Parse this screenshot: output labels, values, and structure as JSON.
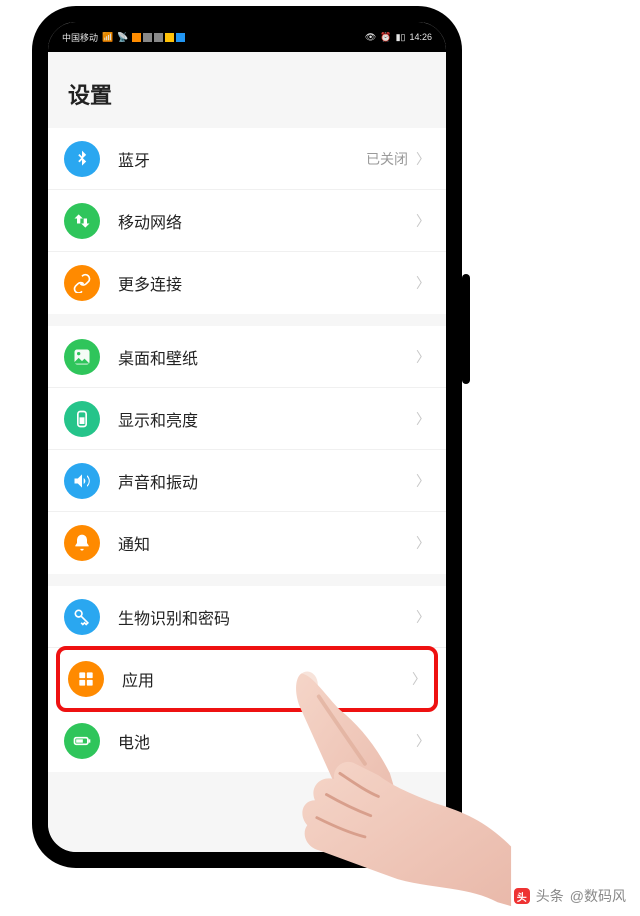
{
  "statusbar": {
    "carrier": "中国移动",
    "signal": "4G+",
    "time": "14:26",
    "battery_icon": "battery"
  },
  "page": {
    "title": "设置"
  },
  "items": [
    {
      "label": "蓝牙",
      "value": "已关闭",
      "icon": "bluetooth",
      "color": "bg-blue"
    },
    {
      "label": "移动网络",
      "value": "",
      "icon": "arrows",
      "color": "bg-green"
    },
    {
      "label": "更多连接",
      "value": "",
      "icon": "link",
      "color": "bg-orange"
    },
    {
      "label": "桌面和壁纸",
      "value": "",
      "icon": "image",
      "color": "bg-green"
    },
    {
      "label": "显示和亮度",
      "value": "",
      "icon": "brightness",
      "color": "bg-teal"
    },
    {
      "label": "声音和振动",
      "value": "",
      "icon": "sound",
      "color": "bg-blue"
    },
    {
      "label": "通知",
      "value": "",
      "icon": "bell",
      "color": "bg-orange"
    },
    {
      "label": "生物识别和密码",
      "value": "",
      "icon": "key",
      "color": "bg-blue"
    },
    {
      "label": "应用",
      "value": "",
      "icon": "apps",
      "color": "bg-orange",
      "highlight": true
    },
    {
      "label": "电池",
      "value": "",
      "icon": "battery",
      "color": "bg-green"
    }
  ],
  "watermark": {
    "prefix": "头条",
    "author": "@数码风"
  }
}
